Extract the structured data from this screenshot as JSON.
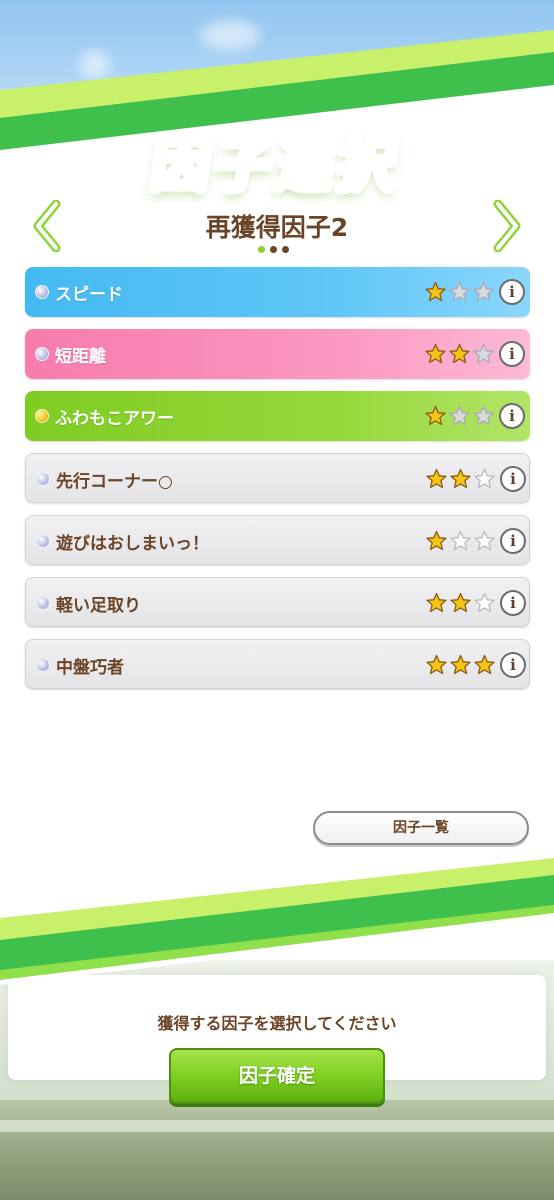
{
  "screen": {
    "title": "因子選択",
    "subtitle": "再獲得因子2",
    "page_indicator": {
      "current": 1,
      "total": 3
    }
  },
  "factors": [
    {
      "name": "スピード",
      "color": "blue",
      "gem": "silver",
      "stars": 1
    },
    {
      "name": "短距離",
      "color": "pink",
      "gem": "silver",
      "stars": 2
    },
    {
      "name": "ふわもこアワー",
      "color": "green",
      "gem": "gold",
      "stars": 1
    },
    {
      "name": "先行コーナー○",
      "color": "white",
      "gem": "silver",
      "stars": 2
    },
    {
      "name": "遊びはおしまいっ！",
      "color": "white",
      "gem": "silver",
      "stars": 1
    },
    {
      "name": "軽い足取り",
      "color": "white",
      "gem": "silver",
      "stars": 2
    },
    {
      "name": "中盤巧者",
      "color": "white",
      "gem": "silver",
      "stars": 3
    }
  ],
  "info_label": "i",
  "list_button_label": "因子一覧",
  "instruction": "獲得する因子を選択してください",
  "confirm_button_label": "因子確定",
  "colors": {
    "brown_text": "#6b4326",
    "accent_green": "#8cd12a",
    "star_gold": "#f5c518"
  }
}
